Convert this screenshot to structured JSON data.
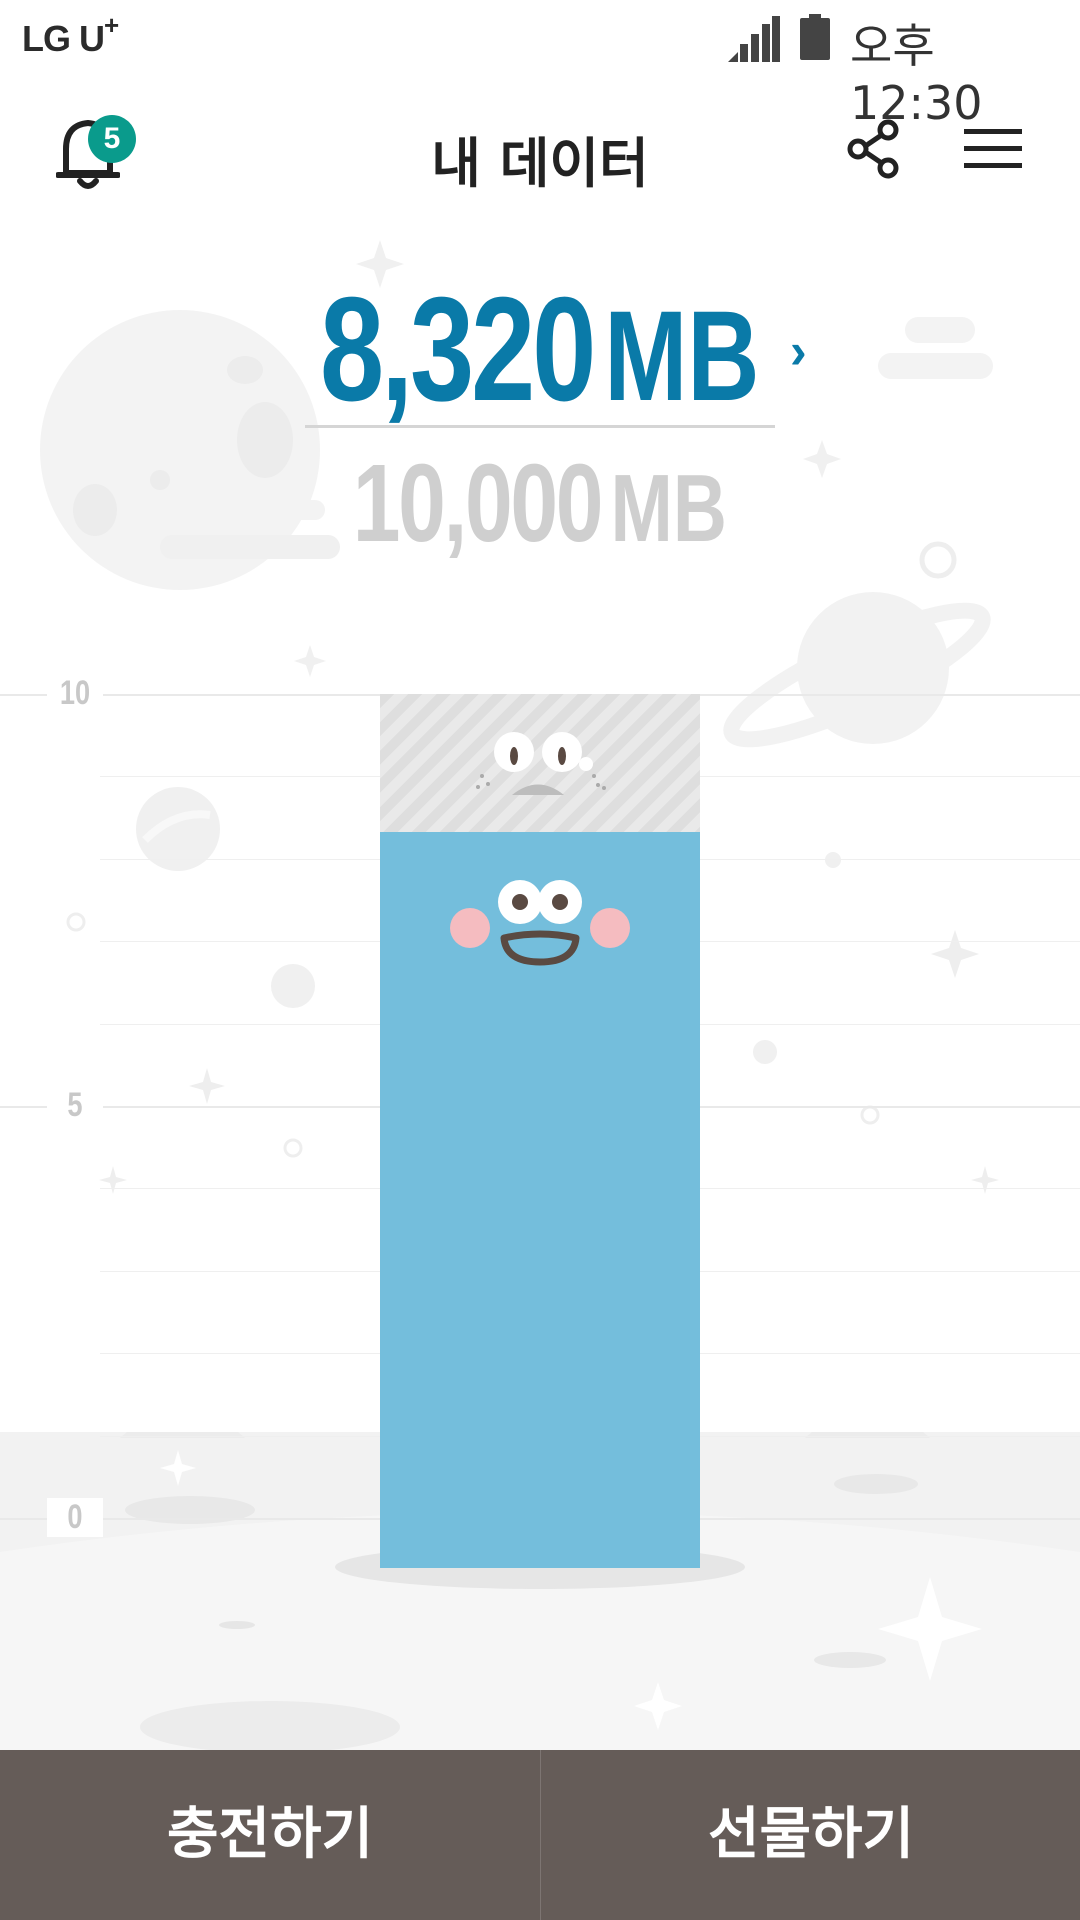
{
  "status_bar": {
    "carrier": "LG U",
    "carrier_plus": "+",
    "time": "오후 12:30"
  },
  "app_bar": {
    "title": "내 데이터",
    "notification_count": "5",
    "icons": [
      "bell-icon",
      "share-icon",
      "hamburger-menu-icon"
    ]
  },
  "data_usage": {
    "remaining_value": "8,320",
    "remaining_unit": "MB",
    "total_value": "10,000",
    "total_unit": "MB",
    "detail_arrow": "›"
  },
  "chart_data": {
    "type": "bar",
    "categories": [
      ""
    ],
    "series": [
      {
        "values": [
          8.32
        ]
      },
      {
        "values": [
          10
        ]
      }
    ],
    "ylim": [
      0,
      10
    ],
    "yticks": [
      "10",
      "5",
      "0"
    ],
    "grid": true,
    "colors": {
      "used": "#74bedc",
      "total": "#dedede"
    }
  },
  "actions": {
    "charge_label": "충전하기",
    "gift_label": "선물하기"
  },
  "colors": {
    "accent": "#0a7aa8",
    "badge": "#0a9b8c",
    "bottom_bar": "#655c58"
  }
}
